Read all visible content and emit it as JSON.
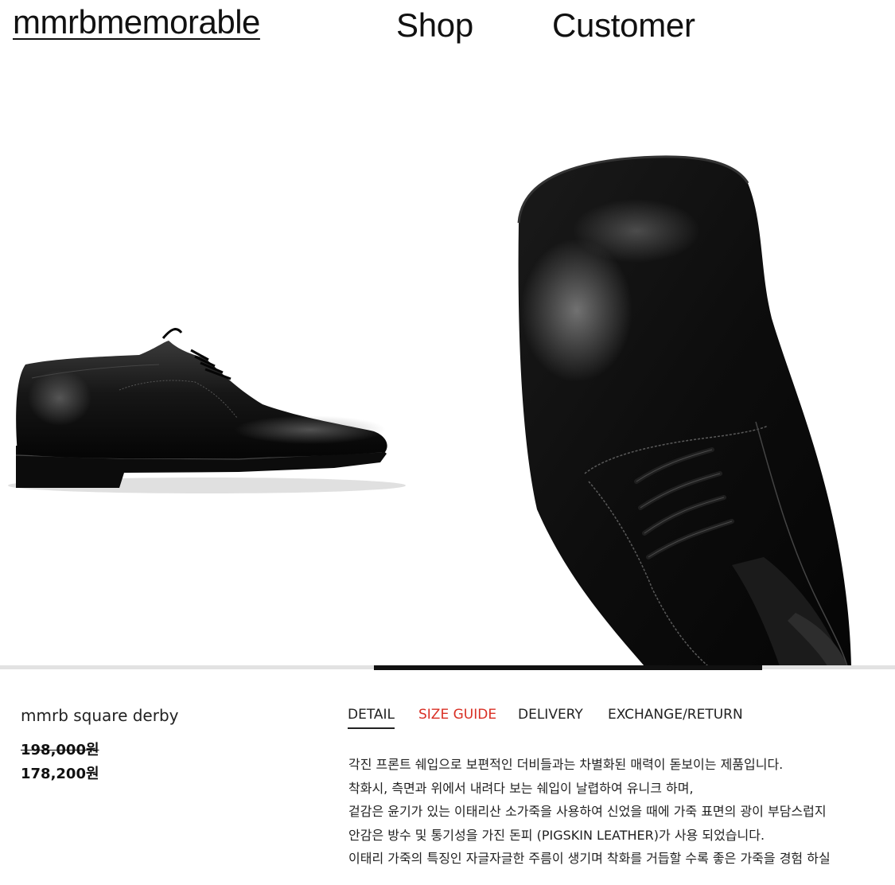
{
  "header": {
    "logo": "mmrbmemorable",
    "nav": [
      "Shop",
      "Customer"
    ]
  },
  "gallery": {
    "slides": [
      "shoe-side-view",
      "shoe-toe-closeup"
    ],
    "progress": 0.43
  },
  "product": {
    "name": "mmrb square derby",
    "price_original": "198,000원",
    "price_sale": "178,200원"
  },
  "tabs": {
    "items": [
      "DETAIL",
      "SIZE GUIDE",
      "DELIVERY",
      "EXCHANGE/RETURN"
    ],
    "highlight_color": "#d93025"
  },
  "description": [
    "각진 프론트 쉐입으로 보편적인 더비들과는 차별화된 매력이 돋보이는 제품입니다.",
    "착화시, 측면과 위에서 내려다 보는 쉐입이 날렵하여 유니크 하며,",
    "겉감은 윤기가 있는 이태리산 소가죽을 사용하여 신었을 때에 가죽 표면의 광이 부담스럽지",
    "안감은 방수 및 통기성을 가진 돈피 (PIGSKIN LEATHER)가 사용 되었습니다.",
    "이태리 가죽의 특징인 자글자글한 주름이 생기며 착화를 거듭할 수록 좋은 가죽을 경험 하실"
  ]
}
